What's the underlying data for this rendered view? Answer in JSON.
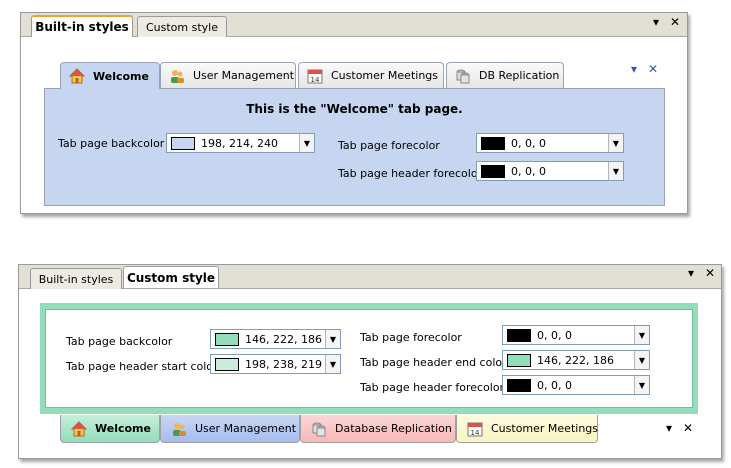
{
  "panel1": {
    "outer_tabs": [
      "Built-in styles",
      "Custom style"
    ],
    "pin_icon": "pin-down-icon",
    "close_glyph": "✕",
    "pin_glyph": "▾",
    "inner_tabs": [
      {
        "label": "Welcome",
        "icon": "home-icon"
      },
      {
        "label": "User Management",
        "icon": "users-icon"
      },
      {
        "label": "Customer Meetings",
        "icon": "calendar-icon",
        "calendar_day": "14"
      },
      {
        "label": "DB Replication",
        "icon": "database-icon"
      }
    ],
    "heading": "This is the \"Welcome\"  tab page.",
    "fields": {
      "backcolor_label": "Tab page backcolor",
      "backcolor_value": "198, 214, 240",
      "backcolor_swatch": "#c6d6f0",
      "forecolor_label": "Tab page forecolor",
      "forecolor_value": "0, 0, 0",
      "forecolor_swatch": "#000000",
      "header_forecolor_label": "Tab page header forecolor",
      "header_forecolor_value": "0, 0, 0",
      "header_forecolor_swatch": "#000000"
    }
  },
  "panel2": {
    "outer_tabs": [
      "Built-in styles",
      "Custom style"
    ],
    "close_glyph": "✕",
    "pin_glyph": "▾",
    "fields": {
      "backcolor_label": "Tab page backcolor",
      "backcolor_value": "146, 222, 186",
      "backcolor_swatch": "#92deba",
      "header_start_label": "Tab page header start color",
      "header_start_value": "198, 238, 219",
      "header_start_swatch": "#c6eedb",
      "forecolor_label": "Tab page forecolor",
      "forecolor_value": "0, 0, 0",
      "forecolor_swatch": "#000000",
      "header_end_label": "Tab page header end color",
      "header_end_value": "146, 222, 186",
      "header_end_swatch": "#92deba",
      "header_forecolor_label": "Tab page header forecolor",
      "header_forecolor_value": "0, 0, 0",
      "header_forecolor_swatch": "#000000"
    },
    "bottom_tabs": [
      {
        "label": "Welcome",
        "icon": "home-icon",
        "color": "#92deba"
      },
      {
        "label": "User Management",
        "icon": "users-icon",
        "color": "#a6bcec"
      },
      {
        "label": "Database Replication",
        "icon": "database-icon",
        "color": "#f7b8b8"
      },
      {
        "label": "Customer Meetings",
        "icon": "calendar-icon",
        "color": "#f8f4c0",
        "calendar_day": "14"
      }
    ]
  }
}
